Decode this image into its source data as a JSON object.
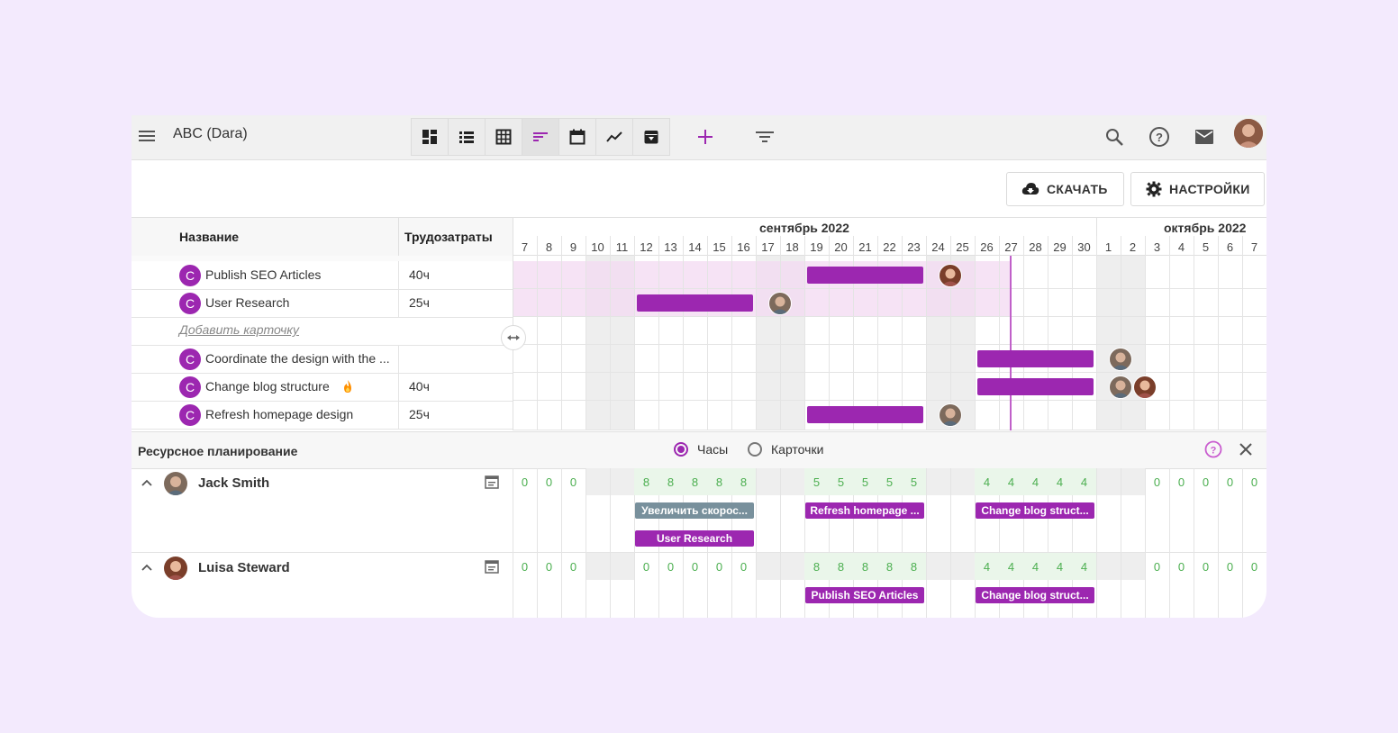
{
  "app": {
    "title": "ABC (Dara)"
  },
  "toolbar": {
    "views": [
      "dashboard-icon",
      "list-view-icon",
      "table-view-icon",
      "gantt-view-icon",
      "calendar-view-icon",
      "chart-view-icon",
      "archive-icon"
    ],
    "add_icon": "plus-icon",
    "filter_icon": "filter-icon",
    "search_icon": "search-icon",
    "help_icon": "help-icon",
    "mail_icon": "mail-icon"
  },
  "actions": {
    "download_label": "СКАЧАТЬ",
    "settings_label": "НАСТРОЙКИ"
  },
  "table": {
    "col_name": "Название",
    "col_effort": "Трудозатраты",
    "add_card": "Добавить карточку",
    "rows": [
      {
        "icon": "C",
        "name": "Publish SEO Articles",
        "effort": "40ч"
      },
      {
        "icon": "C",
        "name": "User Research",
        "effort": "25ч"
      },
      {
        "icon": "C",
        "name": "Coordinate the design with the ...",
        "effort": ""
      },
      {
        "icon": "C",
        "name": "Change blog structure",
        "effort": "40ч",
        "fire": true
      },
      {
        "icon": "C",
        "name": "Refresh homepage design",
        "effort": "25ч"
      }
    ]
  },
  "timeline": {
    "month1": "сентябрь 2022",
    "month2": "октябрь 2022",
    "days": [
      "7",
      "8",
      "9",
      "10",
      "11",
      "12",
      "13",
      "14",
      "15",
      "16",
      "17",
      "18",
      "19",
      "20",
      "21",
      "22",
      "23",
      "24",
      "25",
      "26",
      "27",
      "28",
      "29",
      "30",
      "1",
      "2",
      "3",
      "4",
      "5",
      "6",
      "7"
    ],
    "weekend_days": [
      "10",
      "11",
      "17",
      "18",
      "24",
      "25",
      "1",
      "2"
    ],
    "today": "27"
  },
  "resources": {
    "title": "Ресурсное планирование",
    "option_hours": "Часы",
    "option_cards": "Карточки",
    "selected": "Часы",
    "people": [
      {
        "name": "Jack Smith",
        "hours": [
          "0",
          "0",
          "0",
          "",
          "",
          "8",
          "8",
          "8",
          "8",
          "8",
          "",
          "",
          "5",
          "5",
          "5",
          "5",
          "5",
          "",
          "",
          "4",
          "4",
          "4",
          "4",
          "4",
          "",
          "",
          "0",
          "0",
          "0",
          "0",
          "0"
        ],
        "chips": [
          {
            "label": "Увеличить скорос...",
            "color": "#78909c"
          },
          {
            "label": "Refresh homepage ...",
            "color": "#9c27b0"
          },
          {
            "label": "Change blog struct...",
            "color": "#9c27b0"
          },
          {
            "label": "User Research",
            "color": "#9c27b0"
          }
        ]
      },
      {
        "name": "Luisa Steward",
        "hours": [
          "0",
          "0",
          "0",
          "",
          "",
          "0",
          "0",
          "0",
          "0",
          "0",
          "",
          "",
          "8",
          "8",
          "8",
          "8",
          "8",
          "",
          "",
          "4",
          "4",
          "4",
          "4",
          "4",
          "",
          "",
          "0",
          "0",
          "0",
          "0",
          "0"
        ],
        "chips": [
          {
            "label": "Publish SEO Articles",
            "color": "#9c27b0"
          },
          {
            "label": "Change blog struct...",
            "color": "#9c27b0"
          }
        ]
      }
    ]
  },
  "colors": {
    "accent": "#9c27b0",
    "hours_text": "#4caf50",
    "chip_gray": "#78909c"
  }
}
